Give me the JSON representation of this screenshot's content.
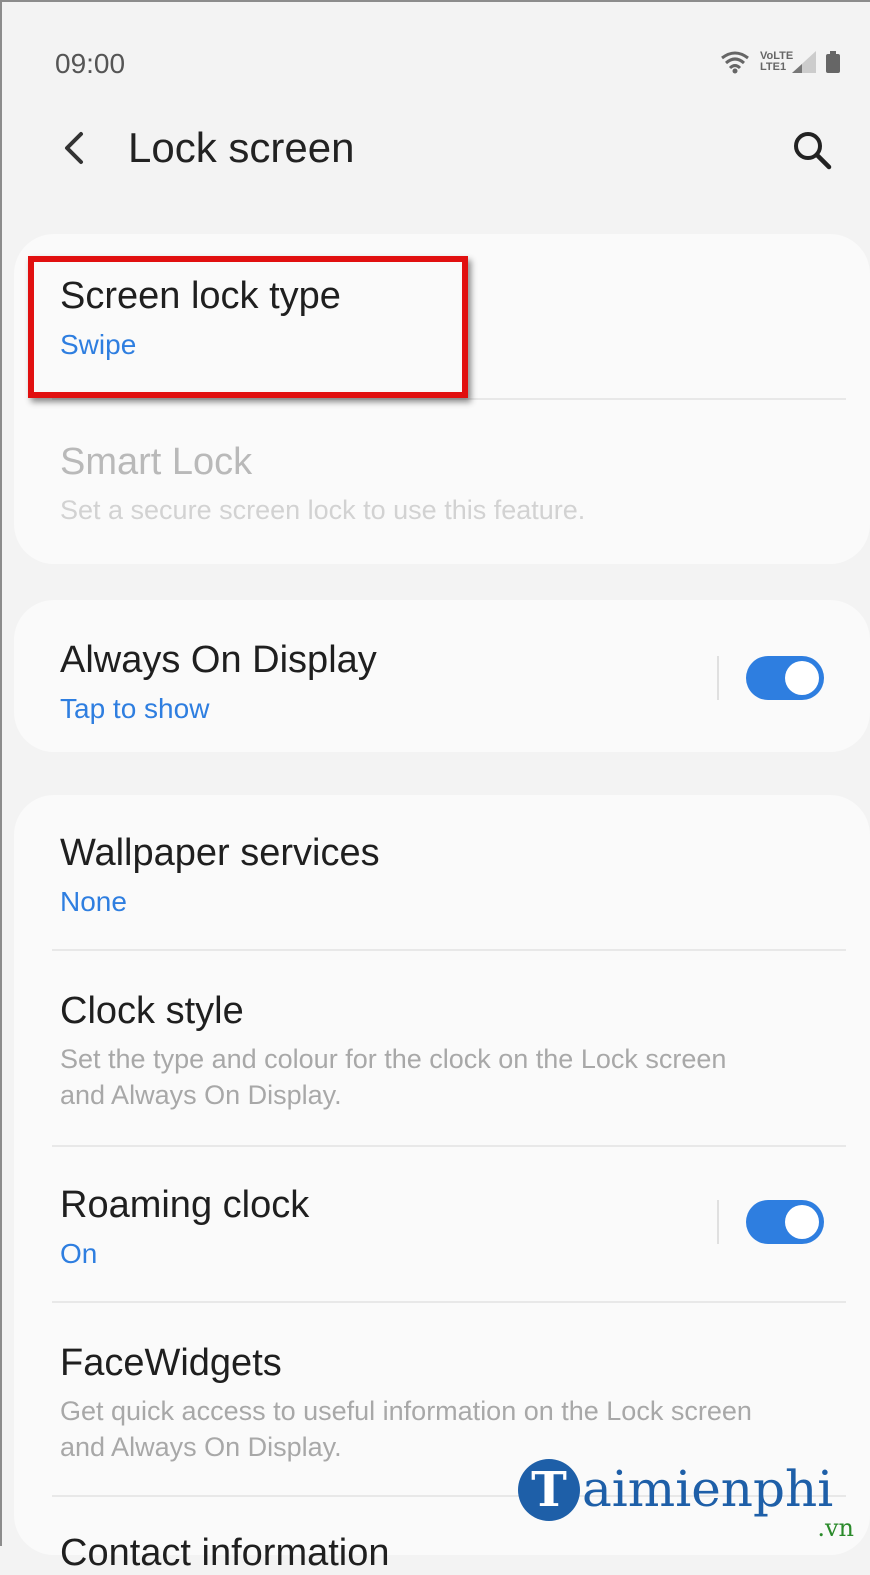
{
  "status_bar": {
    "time": "09:00",
    "lte_label": "VoLTE LTE1"
  },
  "header": {
    "title": "Lock screen",
    "back_icon": "chevron-left-icon",
    "search_icon": "search-icon"
  },
  "colors": {
    "accent": "#2e7ee0",
    "highlight": "#e11010",
    "background": "#f3f3f3",
    "card": "#fafafa"
  },
  "settings": {
    "screen_lock_type": {
      "title": "Screen lock type",
      "value": "Swipe"
    },
    "smart_lock": {
      "title": "Smart Lock",
      "description": "Set a secure screen lock to use this feature.",
      "enabled": false
    },
    "always_on_display": {
      "title": "Always On Display",
      "value": "Tap to show",
      "toggle_on": true
    },
    "wallpaper_services": {
      "title": "Wallpaper services",
      "value": "None"
    },
    "clock_style": {
      "title": "Clock style",
      "description": "Set the type and colour for the clock on the Lock screen and Always On Display."
    },
    "roaming_clock": {
      "title": "Roaming clock",
      "value": "On",
      "toggle_on": true
    },
    "face_widgets": {
      "title": "FaceWidgets",
      "description": "Get quick access to useful information on the Lock screen and Always On Display."
    },
    "contact_information": {
      "title": "Contact information"
    }
  },
  "watermark": {
    "logo_letter": "T",
    "text": "aimienphi",
    "tld": ".vn"
  }
}
